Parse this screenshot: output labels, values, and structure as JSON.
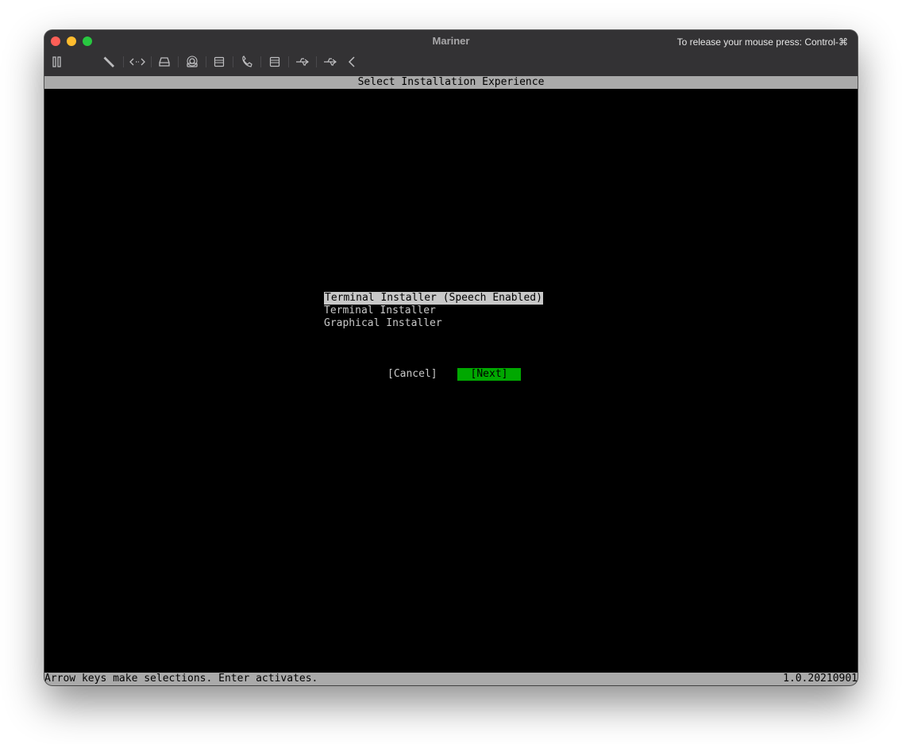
{
  "window": {
    "title": "Mariner",
    "release_hint": "To release your mouse press: Control-⌘"
  },
  "toolbar": {
    "icons": [
      "pause-icon",
      "wrench-icon",
      "code-arrows-icon",
      "hard-drive-icon",
      "camera-icon",
      "disk-icon",
      "phone-icon",
      "disk-icon",
      "usb-icon",
      "usb-icon",
      "chevron-left-icon"
    ]
  },
  "console": {
    "header": "Select Installation Experience",
    "options": [
      {
        "label": "Terminal Installer (Speech Enabled)",
        "selected": true
      },
      {
        "label": "Terminal Installer",
        "selected": false
      },
      {
        "label": "Graphical Installer",
        "selected": false
      }
    ],
    "cancel_label": "[Cancel]",
    "next_label": "[Next]",
    "status_left": "Arrow keys make selections. Enter activates.",
    "status_right": "1.0.20210901",
    "colors": {
      "bar_gray": "#aaaaaa",
      "next_green": "#00a800",
      "selection_bg": "#c8c8c8"
    }
  }
}
